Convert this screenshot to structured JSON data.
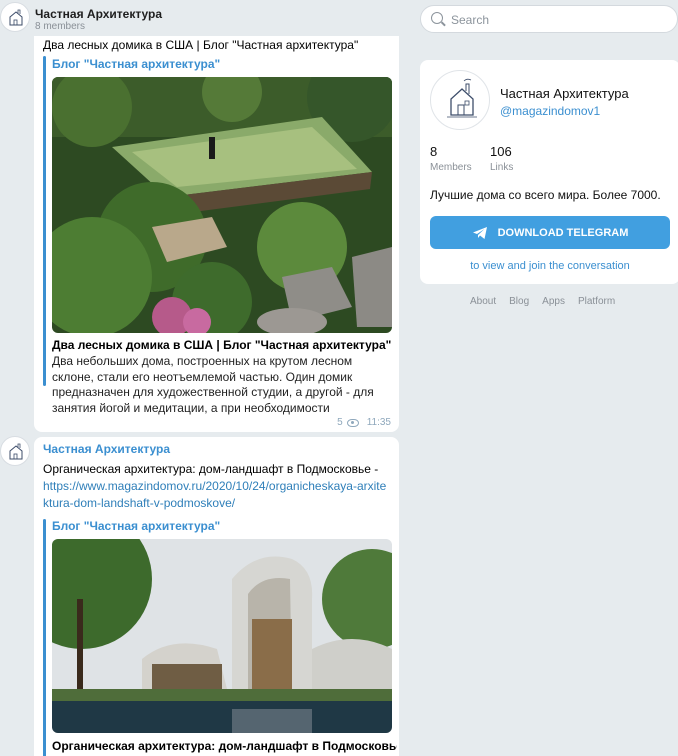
{
  "header": {
    "title": "Частная Архитектура",
    "members": "8 members"
  },
  "post1": {
    "text": "Два лесных домика в США | Блог \"Частная архитектура\"",
    "preview": {
      "site": "Блог \"Частная архитектура\"",
      "title": "Два лесных домика в США | Блог \"Частная архитектура\"",
      "description": "Два небольших дома, построенных на крутом лесном склоне, стали его неотъемлемой частью. Один домик предназначен для художественной студии, а другой - для занятия йогой и медитации, а при необходимости"
    },
    "views": "5",
    "time": "11:35"
  },
  "post2": {
    "author": "Частная Архитектура",
    "text": "Органическая архитектура: дом-ландшафт в Подмосковье - ",
    "link": "https://www.magazindomov.ru/2020/10/24/organicheskaya-arxitektura-dom-landshaft-v-podmoskove/",
    "preview": {
      "site": "Блог \"Частная архитектура\"",
      "title": "Органическая архитектура: дом-ландшафт в Подмосковье | |"
    }
  },
  "search": {
    "placeholder": "Search"
  },
  "channel": {
    "name": "Частная Архитектура",
    "handle": "@magazindomov1",
    "members_count": "8",
    "members_label": "Members",
    "links_count": "106",
    "links_label": "Links",
    "about": "Лучшие дома со всего мира. Более 7000.",
    "download_label": "DOWNLOAD TELEGRAM",
    "hint": "to view and join the conversation"
  },
  "footer": {
    "links": [
      "About",
      "Blog",
      "Apps",
      "Platform"
    ]
  },
  "colors": {
    "accent": "#419fe0",
    "link": "#3b8fd0",
    "background": "#e6ebee"
  }
}
